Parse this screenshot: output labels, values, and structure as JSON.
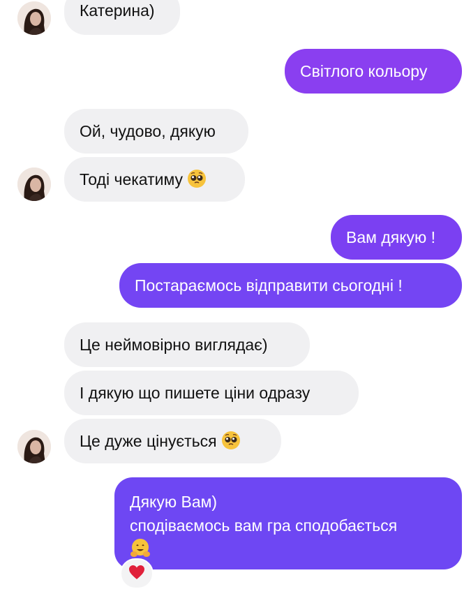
{
  "messages": [
    {
      "id": "m1",
      "side": "in",
      "text": "Катерина)"
    },
    {
      "id": "m2",
      "side": "out",
      "text": "Світлого кольору"
    },
    {
      "id": "m3",
      "side": "in",
      "text": "Ой, чудово, дякую"
    },
    {
      "id": "m4",
      "side": "in",
      "text": "Тоді чекатиму",
      "emoji": "pleading-face"
    },
    {
      "id": "m5",
      "side": "out",
      "text": "Вам дякую !"
    },
    {
      "id": "m6",
      "side": "out",
      "text": "Постараємось відправити сьогодні !"
    },
    {
      "id": "m7",
      "side": "in",
      "text": "Це неймовірно виглядає)"
    },
    {
      "id": "m8",
      "side": "in",
      "text": "І дякую що пишете ціни одразу"
    },
    {
      "id": "m9",
      "side": "in",
      "text": "Це дуже цінується",
      "emoji": "pleading-face"
    },
    {
      "id": "m10",
      "side": "out",
      "lines": [
        "Дякую Вам)",
        "сподіваємось вам гра сподобається"
      ],
      "emoji": "hugging-face",
      "reaction": "red-heart"
    }
  ],
  "colors": {
    "incoming_bubble": "#f0f0f2",
    "outgoing_bubble": "#7d3ef0",
    "outgoing_text": "#ffffff",
    "incoming_text": "#111111"
  }
}
